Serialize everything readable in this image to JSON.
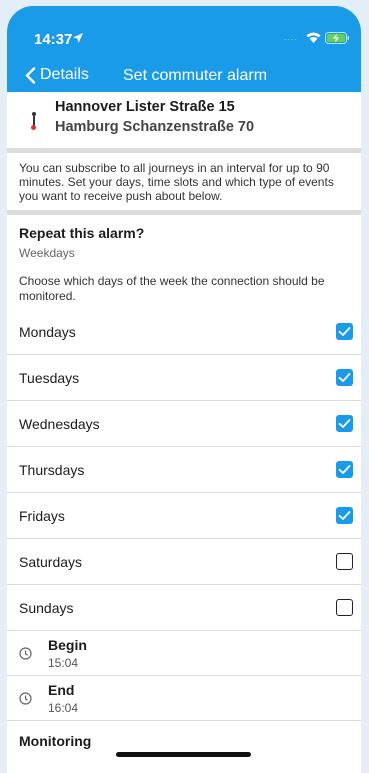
{
  "status": {
    "time": "14:37",
    "dots": "....",
    "icons": [
      "location-arrow-icon",
      "wifi-icon",
      "battery-charging-icon"
    ]
  },
  "nav": {
    "back_label": "Details",
    "title": "Set commuter alarm"
  },
  "route": {
    "from": "Hannover Lister Straße 15",
    "to": "Hamburg Schanzenstraße 70"
  },
  "info_text": "You can subscribe to all journeys in an interval for up to 90 minutes. Set your days, time slots and which type of events you want to receive push about below.",
  "repeat": {
    "title": "Repeat this alarm?",
    "subtitle": "Weekdays",
    "description": "Choose which days of the week the connection should be monitored."
  },
  "days": [
    {
      "label": "Mondays",
      "checked": true
    },
    {
      "label": "Tuesdays",
      "checked": true
    },
    {
      "label": "Wednesdays",
      "checked": true
    },
    {
      "label": "Thursdays",
      "checked": true
    },
    {
      "label": "Fridays",
      "checked": true
    },
    {
      "label": "Saturdays",
      "checked": false
    },
    {
      "label": "Sundays",
      "checked": false
    }
  ],
  "begin": {
    "label": "Begin",
    "value": "15:04"
  },
  "end": {
    "label": "End",
    "value": "16:04"
  },
  "monitoring": {
    "label": "Monitoring"
  },
  "colors": {
    "accent": "#1a9be8",
    "background": "#e3eef6",
    "separator": "#dcdcdf"
  }
}
